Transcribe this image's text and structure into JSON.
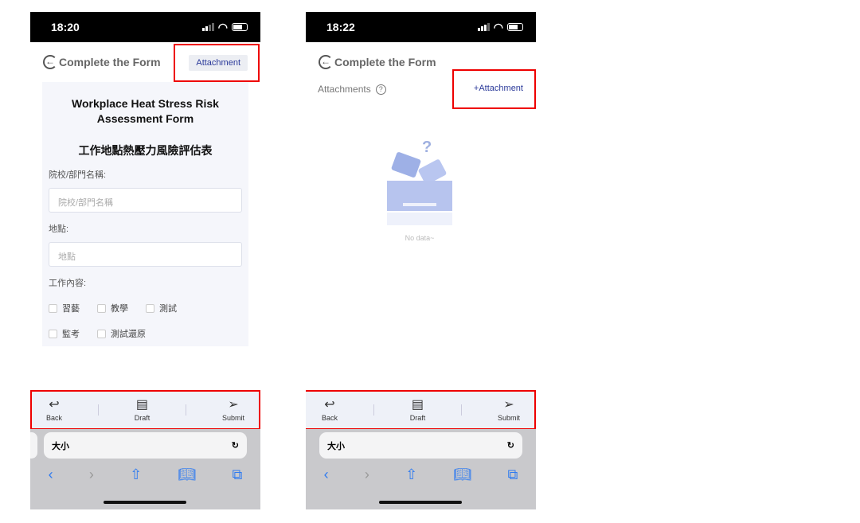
{
  "screen1": {
    "time": "18:20",
    "header_title": "Complete the Form",
    "attachment_button": "Attachment",
    "form": {
      "title": "Workplace Heat Stress Risk Assessment Form",
      "title_zh": "工作地點熱壓力風險評估表",
      "field1_label": "院校/部門名稱:",
      "field1_placeholder": "院校/部門名稱",
      "field2_label": "地點:",
      "field2_placeholder": "地點",
      "work_label": "工作內容:",
      "options": [
        "習藝",
        "教學",
        "測試",
        "監考",
        "測試還原"
      ]
    }
  },
  "screen2": {
    "time": "18:22",
    "header_title": "Complete the Form",
    "attachments_label": "Attachments",
    "help_icon": "?",
    "add_attachment": "+Attachment",
    "empty_text": "No data~"
  },
  "toolbar": {
    "back": "Back",
    "draft": "Draft",
    "submit": "Submit"
  },
  "browser": {
    "text_size": "大小"
  },
  "colors": {
    "accent": "#2b3a9a",
    "highlight": "#e00000",
    "toolbar_bg": "#eef1f8"
  }
}
